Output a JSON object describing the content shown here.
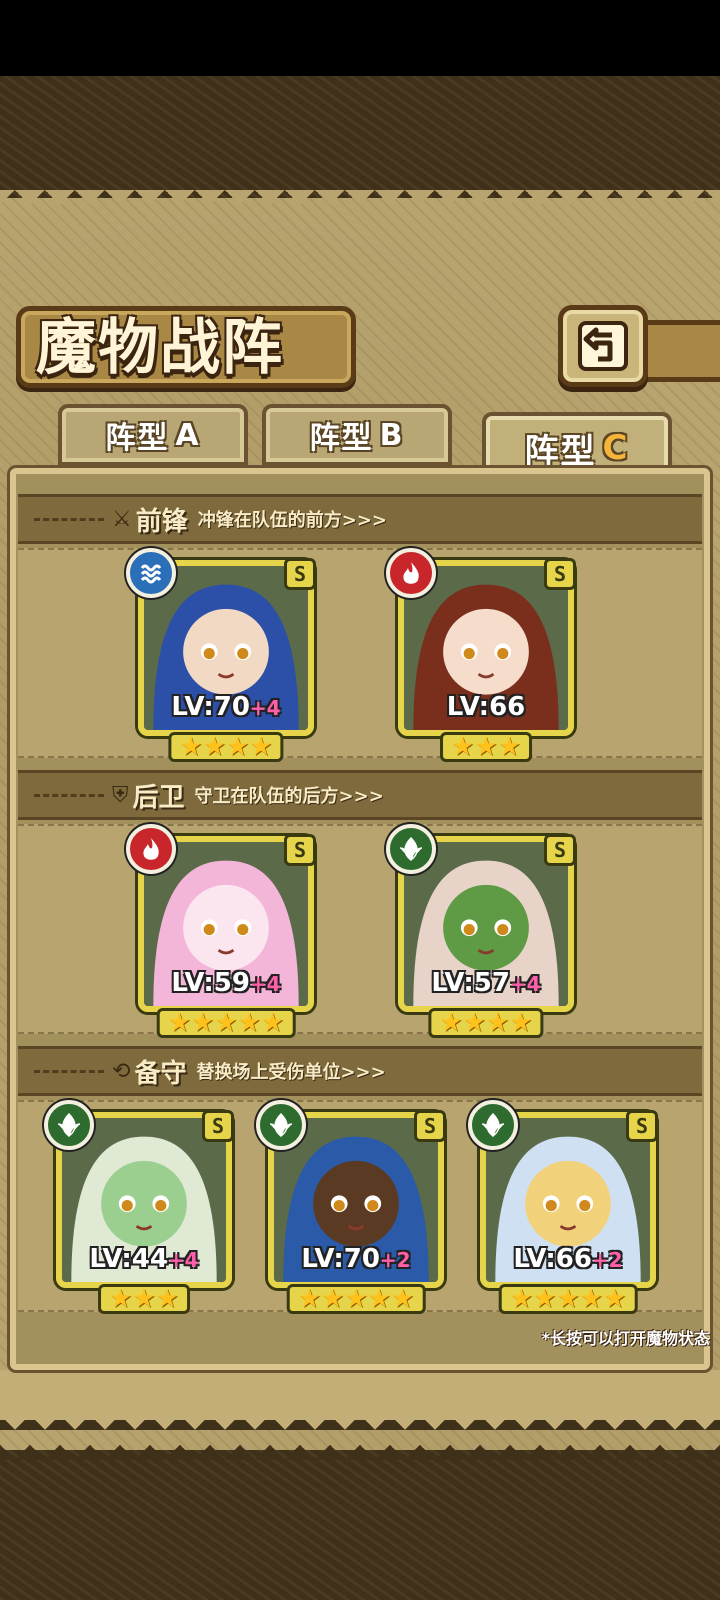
{
  "title": "魔物战阵",
  "tabs": [
    {
      "label": "阵型",
      "suffix": "A"
    },
    {
      "label": "阵型",
      "suffix": "B"
    },
    {
      "label": "阵型",
      "suffix": "C"
    }
  ],
  "sections": {
    "front": {
      "title": "前锋",
      "desc": "冲锋在队伍的前方>>>"
    },
    "back": {
      "title": "后卫",
      "desc": "守卫在队伍的后方>>>"
    },
    "reserve": {
      "title": "备守",
      "desc": "替换场上受伤单位>>>"
    }
  },
  "cards": [
    {
      "element": "water",
      "grade": "S",
      "level": "LV:70",
      "plus": "+4",
      "stars": "★★★★"
    },
    {
      "element": "fire",
      "grade": "S",
      "level": "LV:66",
      "plus": "",
      "stars": "★★★"
    },
    {
      "element": "fire",
      "grade": "S",
      "level": "LV:59",
      "plus": "+4",
      "stars": "★★★★★"
    },
    {
      "element": "leaf",
      "grade": "S",
      "level": "LV:57",
      "plus": "+4",
      "stars": "★★★★"
    },
    {
      "element": "leaf",
      "grade": "S",
      "level": "LV:44",
      "plus": "+4",
      "stars": "★★★"
    },
    {
      "element": "leaf",
      "grade": "S",
      "level": "LV:70",
      "plus": "+2",
      "stars": "★★★★★"
    },
    {
      "element": "leaf",
      "grade": "S",
      "level": "LV:66",
      "plus": "+2",
      "stars": "★★★★★"
    }
  ],
  "footnote": "*长按可以打开魔物状态"
}
